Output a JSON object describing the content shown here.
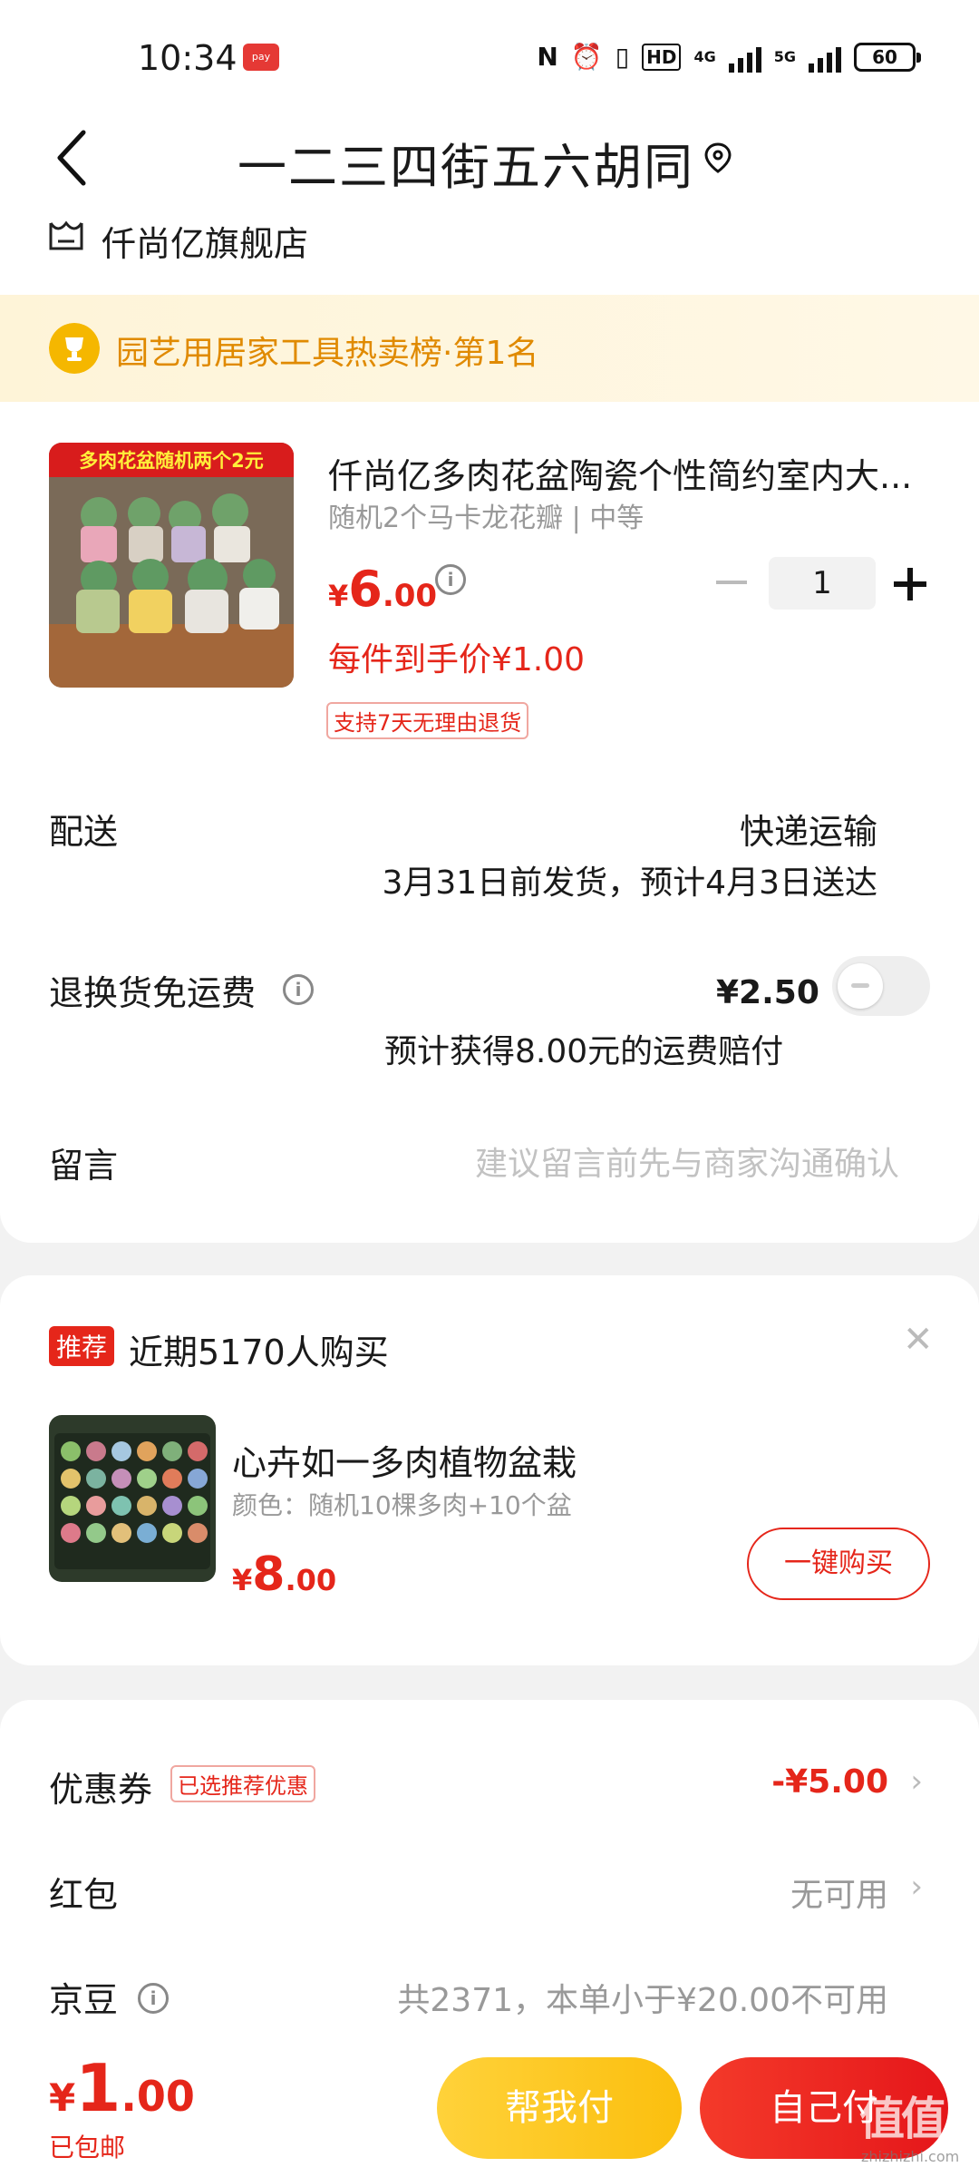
{
  "status_bar": {
    "time": "10:34",
    "battery": "60",
    "network1": "4G",
    "network2": "5G",
    "hd": "HD"
  },
  "header": {
    "address": "一二三四街五六胡同"
  },
  "shop": {
    "name": "仟尚亿旗舰店"
  },
  "rank": {
    "text": "园艺用居家工具热卖榜·第1名"
  },
  "product": {
    "thumb_banner": "多肉花盆随机两个2元",
    "title": "仟尚亿多肉花盆陶瓷个性简约室内大...",
    "spec": "随机2个马卡龙花瓣 | 中等",
    "price_symbol": "¥",
    "price_int": "6",
    "price_dec": ".00",
    "quantity": "1",
    "unit_price_text": "每件到手价¥1.00",
    "return_tag": "支持7天无理由退货"
  },
  "shipping": {
    "label": "配送",
    "mode": "快递运输",
    "date": "3月31日前发货，预计4月3日送达"
  },
  "return_shipping": {
    "label": "退换货免运费",
    "price": "¥2.50",
    "note": "预计获得8.00元的运费赔付",
    "enabled": false
  },
  "message": {
    "label": "留言",
    "placeholder": "建议留言前先与商家沟通确认"
  },
  "recommend": {
    "tag": "推荐",
    "title": "近期5170人购买",
    "item_name": "心卉如一多肉植物盆栽",
    "item_spec": "颜色：随机10棵多肉+10个盆",
    "price_symbol": "¥",
    "price_int": "8",
    "price_dec": ".00",
    "buy_label": "一键购买"
  },
  "discounts": {
    "coupon_label": "优惠券",
    "coupon_tag": "已选推荐优惠",
    "coupon_value": "-¥5.00",
    "redpacket_label": "红包",
    "redpacket_value": "无可用",
    "jd_bean_label": "京豆",
    "jd_bean_value": "共2371，本单小于¥20.00不可用"
  },
  "bottom": {
    "total_symbol": "¥",
    "total_int": "1",
    "total_dec": ".00",
    "free_shipping": "已包邮",
    "help_pay": "帮我付",
    "self_pay": "自己付",
    "watermark": "值值值",
    "watermark_sub": "zhizhizhi.com"
  },
  "colors": {
    "accent": "#e5261a",
    "help_pay": "#fbbf0e",
    "rank_text": "#e08a00"
  }
}
